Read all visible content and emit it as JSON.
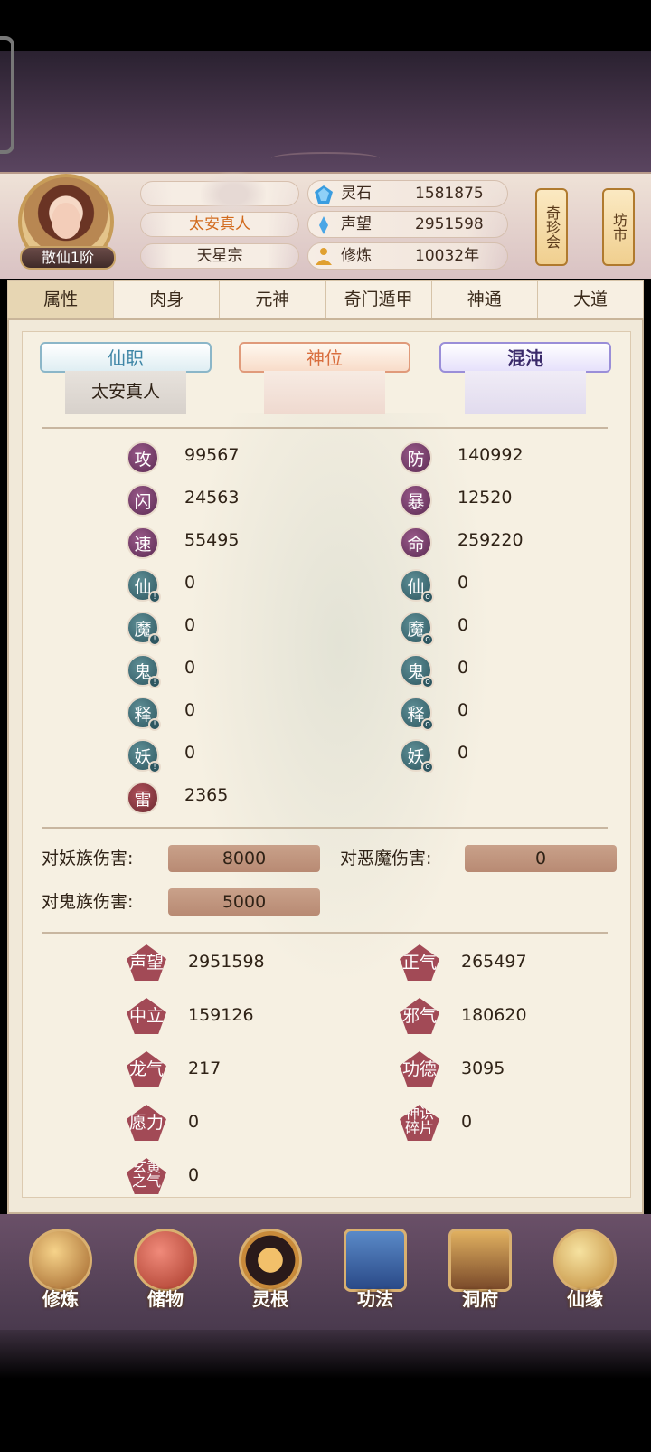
{
  "player": {
    "rank": "散仙1阶",
    "title": "太安真人",
    "sect": "天星宗",
    "name_hidden": ""
  },
  "resources": [
    {
      "label": "灵石",
      "value": "1581875",
      "icon": "spirit-stone-icon",
      "color": "#3a9de0"
    },
    {
      "label": "声望",
      "value": "2951598",
      "icon": "reputation-crystal-icon",
      "color": "#4aa6e6"
    },
    {
      "label": "修炼",
      "value": "10032年",
      "icon": "meditation-icon",
      "color": "#e0a030"
    }
  ],
  "shops": [
    {
      "label": "奇珍会"
    },
    {
      "label": "坊市"
    }
  ],
  "tabs": [
    "属性",
    "肉身",
    "元神",
    "奇门遁甲",
    "神通",
    "大道"
  ],
  "active_tab": "属性",
  "positions": {
    "xianzhi": {
      "label": "仙职",
      "value": "太安真人"
    },
    "shenwei": {
      "label": "神位",
      "value": ""
    },
    "hundun": {
      "label": "混沌",
      "value": ""
    }
  },
  "stats_left": [
    {
      "label": "攻",
      "value": "99567"
    },
    {
      "label": "闪",
      "value": "24563"
    },
    {
      "label": "速",
      "value": "55495"
    },
    {
      "label": "仙",
      "value": "0"
    },
    {
      "label": "魔",
      "value": "0"
    },
    {
      "label": "鬼",
      "value": "0"
    },
    {
      "label": "释",
      "value": "0"
    },
    {
      "label": "妖",
      "value": "0"
    },
    {
      "label": "雷",
      "value": "2365"
    }
  ],
  "stats_right": [
    {
      "label": "防",
      "value": "140992"
    },
    {
      "label": "暴",
      "value": "12520"
    },
    {
      "label": "命",
      "value": "259220"
    },
    {
      "label": "仙",
      "value": "0"
    },
    {
      "label": "魔",
      "value": "0"
    },
    {
      "label": "鬼",
      "value": "0"
    },
    {
      "label": "释",
      "value": "0"
    },
    {
      "label": "妖",
      "value": "0"
    }
  ],
  "damage": [
    {
      "label": "对妖族伤害:",
      "value": "8000"
    },
    {
      "label": "对恶魔伤害:",
      "value": "0"
    },
    {
      "label": "对鬼族伤害:",
      "value": "5000"
    }
  ],
  "reputation": [
    {
      "label": "声望",
      "value": "2951598"
    },
    {
      "label": "正气",
      "value": "265497"
    },
    {
      "label": "中立",
      "value": "159126"
    },
    {
      "label": "邪气",
      "value": "180620"
    },
    {
      "label": "龙气",
      "value": "217"
    },
    {
      "label": "功德",
      "value": "3095"
    },
    {
      "label": "愿力",
      "value": "0"
    },
    {
      "label": "神识碎片",
      "value": "0"
    },
    {
      "label": "玄黄之气",
      "value": "0"
    }
  ],
  "bottom_nav": [
    "修炼",
    "储物",
    "灵根",
    "功法",
    "洞府",
    "仙缘"
  ]
}
